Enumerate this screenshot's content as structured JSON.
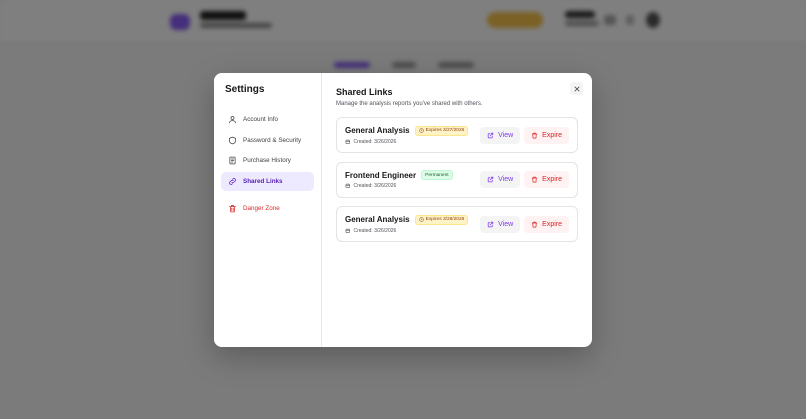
{
  "modal": {
    "title": "Settings"
  },
  "sidebar": {
    "items": [
      {
        "label": "Account Info",
        "icon": "user-icon"
      },
      {
        "label": "Password & Security",
        "icon": "shield-icon"
      },
      {
        "label": "Purchase History",
        "icon": "receipt-icon"
      },
      {
        "label": "Shared Links",
        "icon": "link-icon",
        "active": true
      },
      {
        "label": "Danger Zone",
        "icon": "trash-icon",
        "danger": true
      }
    ]
  },
  "content": {
    "title": "Shared Links",
    "subtitle": "Manage the analysis reports you've shared with others."
  },
  "links": [
    {
      "title": "General Analysis",
      "badge": "Expires 3/27/2026",
      "badge_type": "expires",
      "created": "Created: 3/26/2026",
      "view_label": "View",
      "expire_label": "Expire"
    },
    {
      "title": "Frontend Engineer",
      "badge": "Permanent",
      "badge_type": "permanent",
      "created": "Created: 3/26/2026",
      "view_label": "View",
      "expire_label": "Expire"
    },
    {
      "title": "General Analysis",
      "badge": "Expires 3/28/2026",
      "badge_type": "expires",
      "created": "Created: 3/26/2026",
      "view_label": "View",
      "expire_label": "Expire"
    }
  ],
  "colors": {
    "accent": "#7c3aed",
    "danger": "#dc2626",
    "active_bg": "#ede9fe"
  }
}
